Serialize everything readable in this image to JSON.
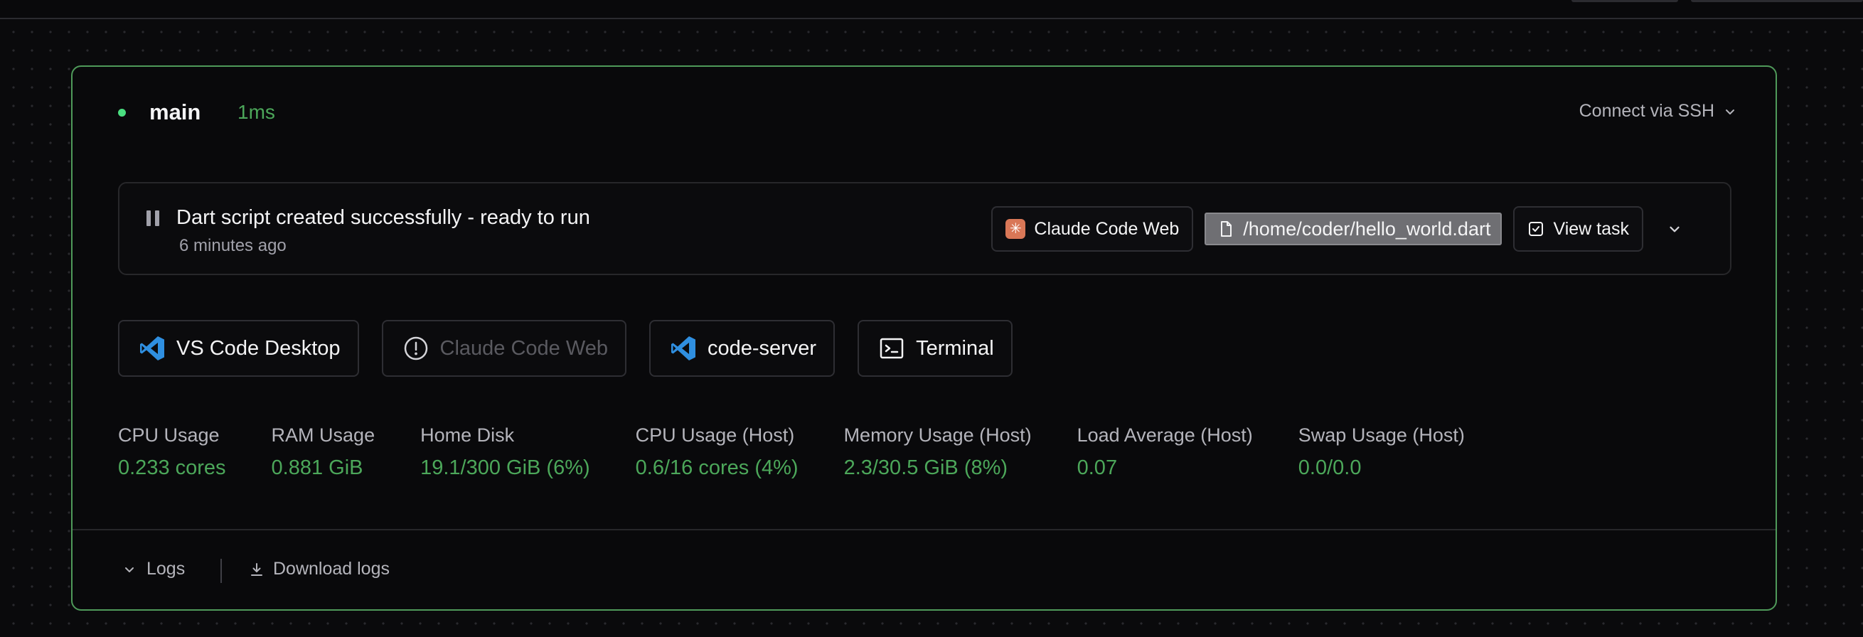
{
  "agent": {
    "name": "main",
    "latency": "1ms",
    "ssh_label": "Connect via SSH"
  },
  "task": {
    "title": "Dart script created successfully - ready to run",
    "time": "6 minutes ago",
    "app_label": "Claude Code Web",
    "file_path": "/home/coder/hello_world.dart",
    "view_task_label": "View task"
  },
  "apps": [
    {
      "label": "VS Code Desktop",
      "icon": "vscode-icon",
      "disabled": false
    },
    {
      "label": "Claude Code Web",
      "icon": "warning-circle-icon",
      "disabled": true
    },
    {
      "label": "code-server",
      "icon": "vscode-icon",
      "disabled": false
    },
    {
      "label": "Terminal",
      "icon": "terminal-icon",
      "disabled": false
    }
  ],
  "metrics": [
    {
      "label": "CPU Usage",
      "value": "0.233 cores"
    },
    {
      "label": "RAM Usage",
      "value": "0.881 GiB"
    },
    {
      "label": "Home Disk",
      "value": "19.1/300 GiB (6%)"
    },
    {
      "label": "CPU Usage (Host)",
      "value": "0.6/16 cores (4%)"
    },
    {
      "label": "Memory Usage (Host)",
      "value": "2.3/30.5 GiB (8%)"
    },
    {
      "label": "Load Average (Host)",
      "value": "0.07"
    },
    {
      "label": "Swap Usage (Host)",
      "value": "0.0/0.0"
    }
  ],
  "footer": {
    "logs_label": "Logs",
    "download_label": "Download logs"
  },
  "colors": {
    "accent_green": "#4ca75a",
    "border_green": "#4f9a5a",
    "claude_orange": "#d97757",
    "vscode_blue": "#2f8fe0"
  }
}
